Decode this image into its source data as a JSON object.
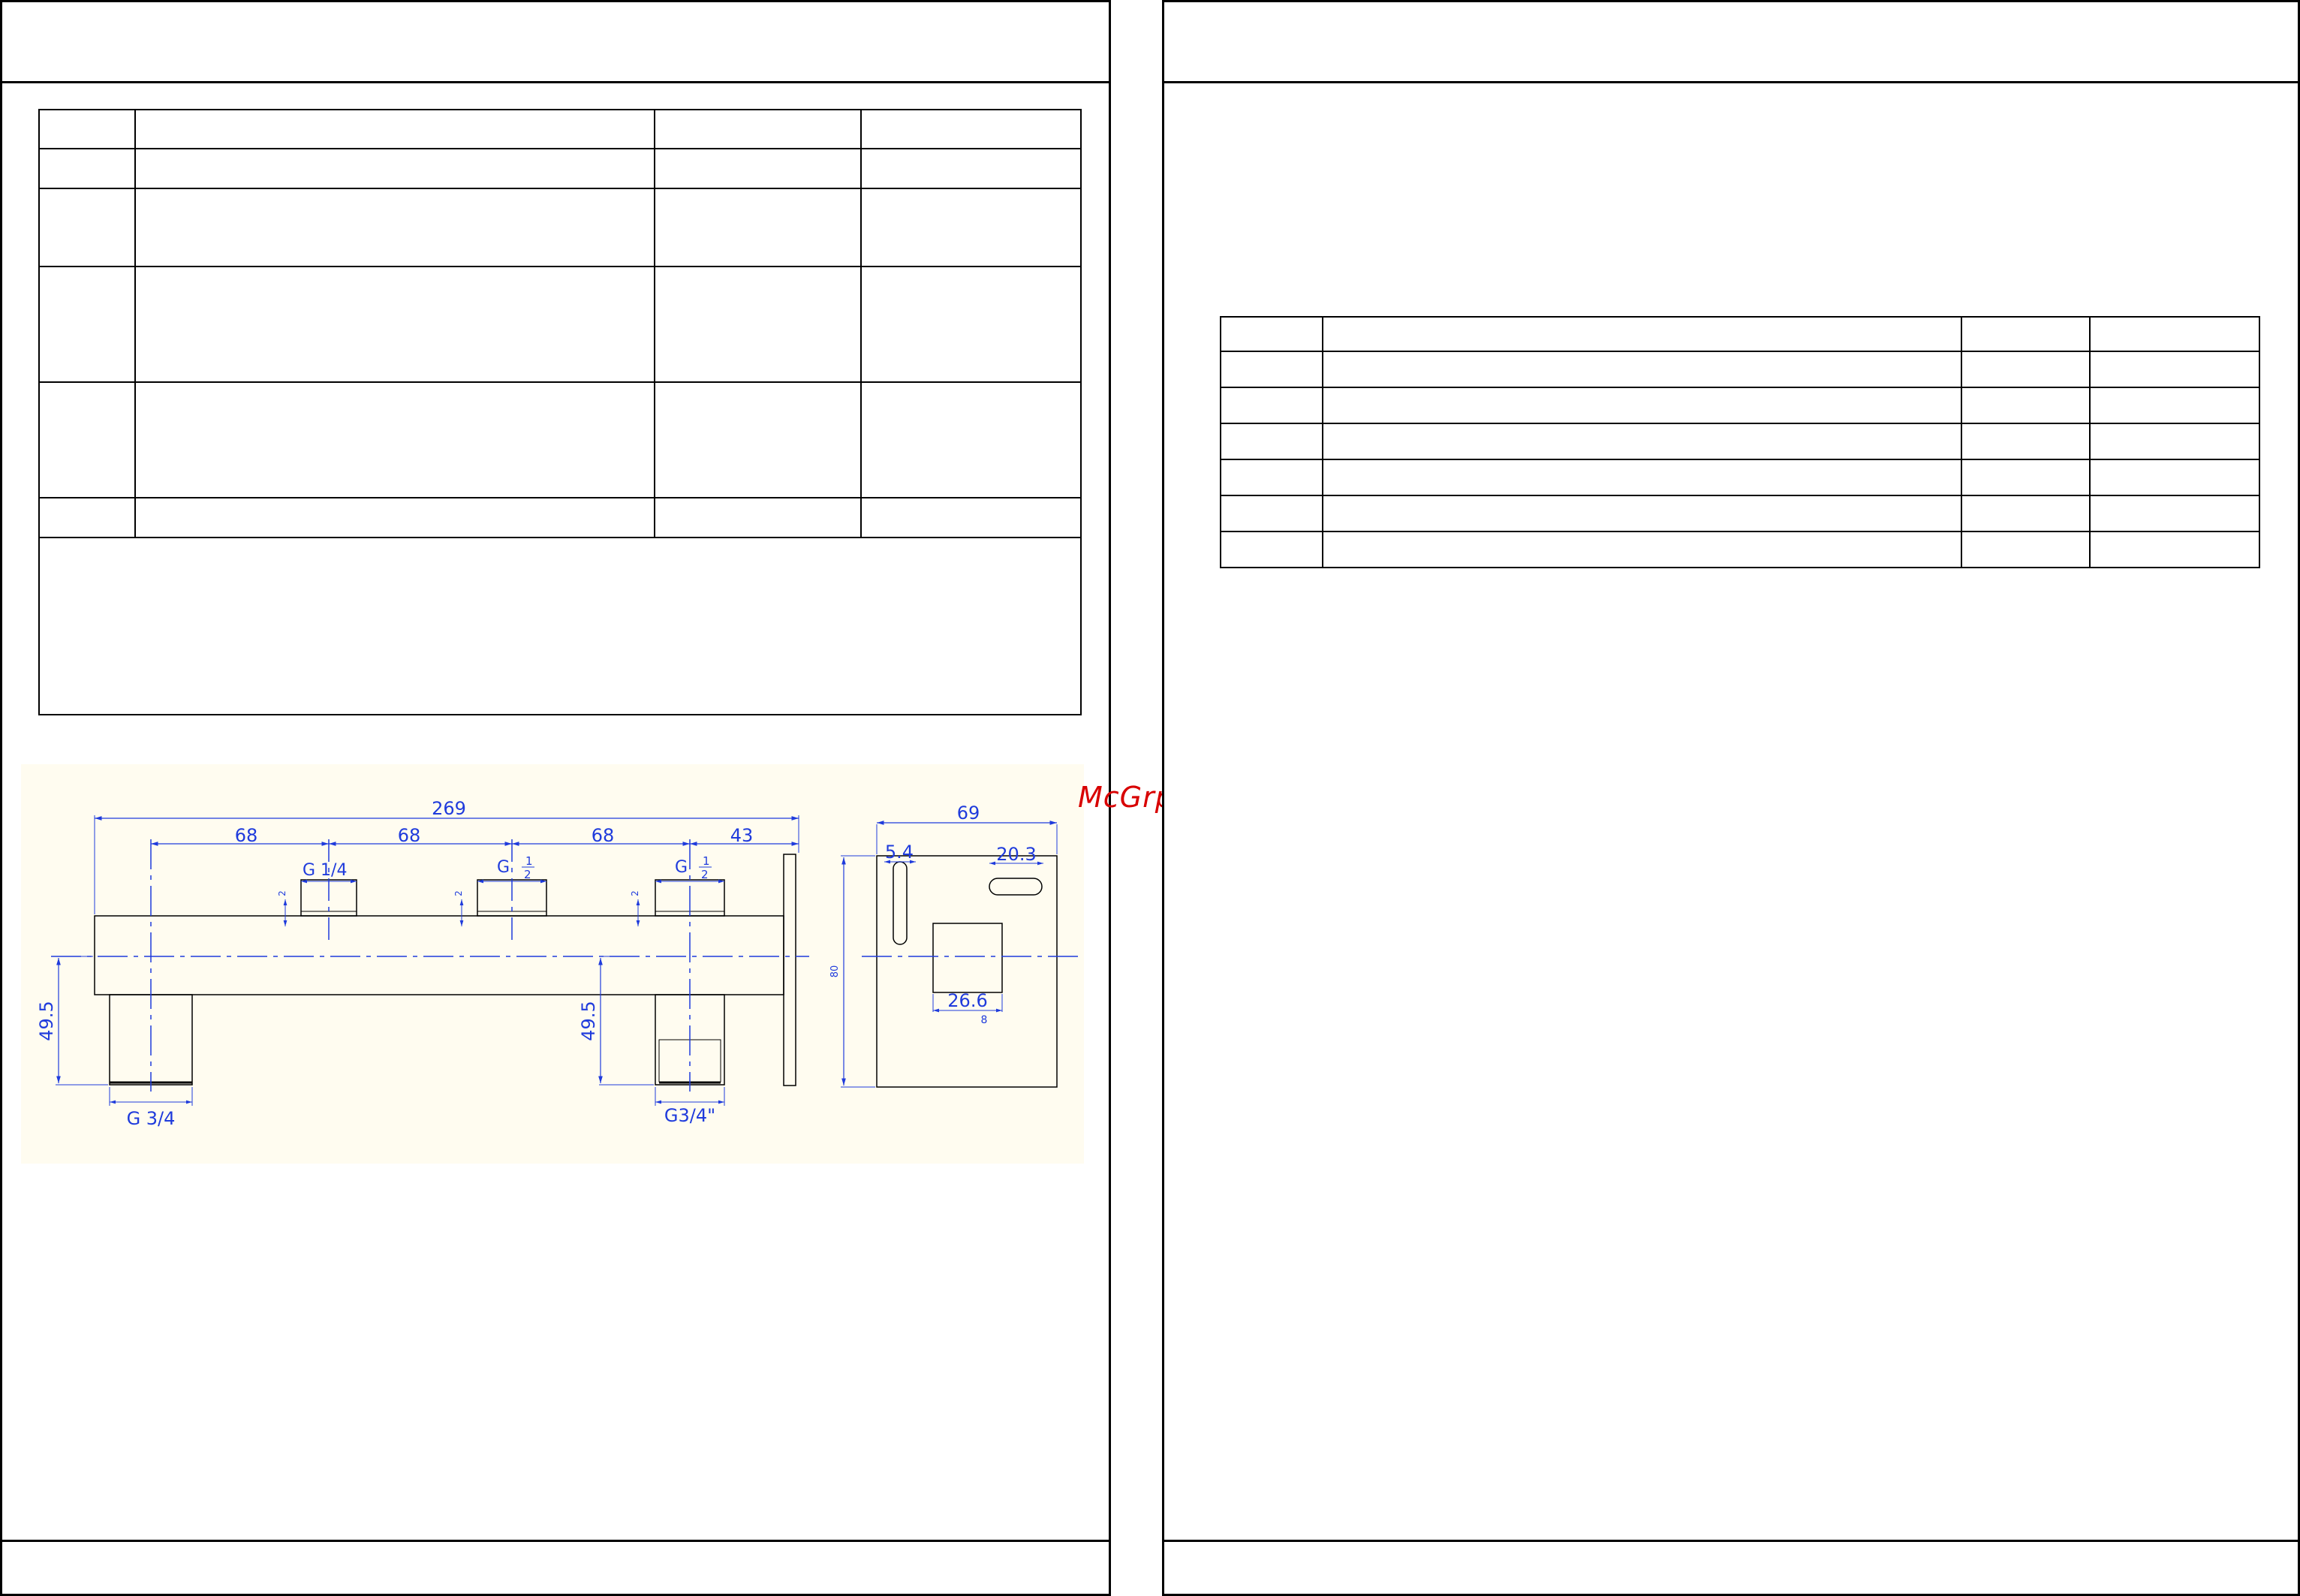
{
  "watermark": "McGrp.Ru",
  "colors": {
    "dimension": "#1f3bdc",
    "outline": "#000000",
    "drawing_bg": "#fffcf0",
    "watermark": "#d80000"
  },
  "left_page": {
    "spec_table_rows": 6,
    "spec_table_cols": 4
  },
  "right_page": {
    "parts_table_rows": 7,
    "parts_table_cols": 4
  },
  "drawing": {
    "front_view": {
      "overall_length": "269",
      "spacing_1": "68",
      "spacing_2": "68",
      "spacing_3": "68",
      "end_offset": "43",
      "thread_1": "G 1/4",
      "thread_2_prefix": "G",
      "thread_2_num": "1",
      "thread_2_den": "2",
      "thread_3_prefix": "G",
      "thread_3_num": "1",
      "thread_3_den": "2",
      "small_dim": "2",
      "height_left": "49.5",
      "height_right": "49.5",
      "bottom_thread_left": "G 3/4",
      "bottom_thread_right": "G3/4\""
    },
    "side_view": {
      "width": "69",
      "offset": "5.4",
      "slot_width": "20.3",
      "square_width": "26.6",
      "square_sub": "8",
      "height": "80"
    }
  }
}
